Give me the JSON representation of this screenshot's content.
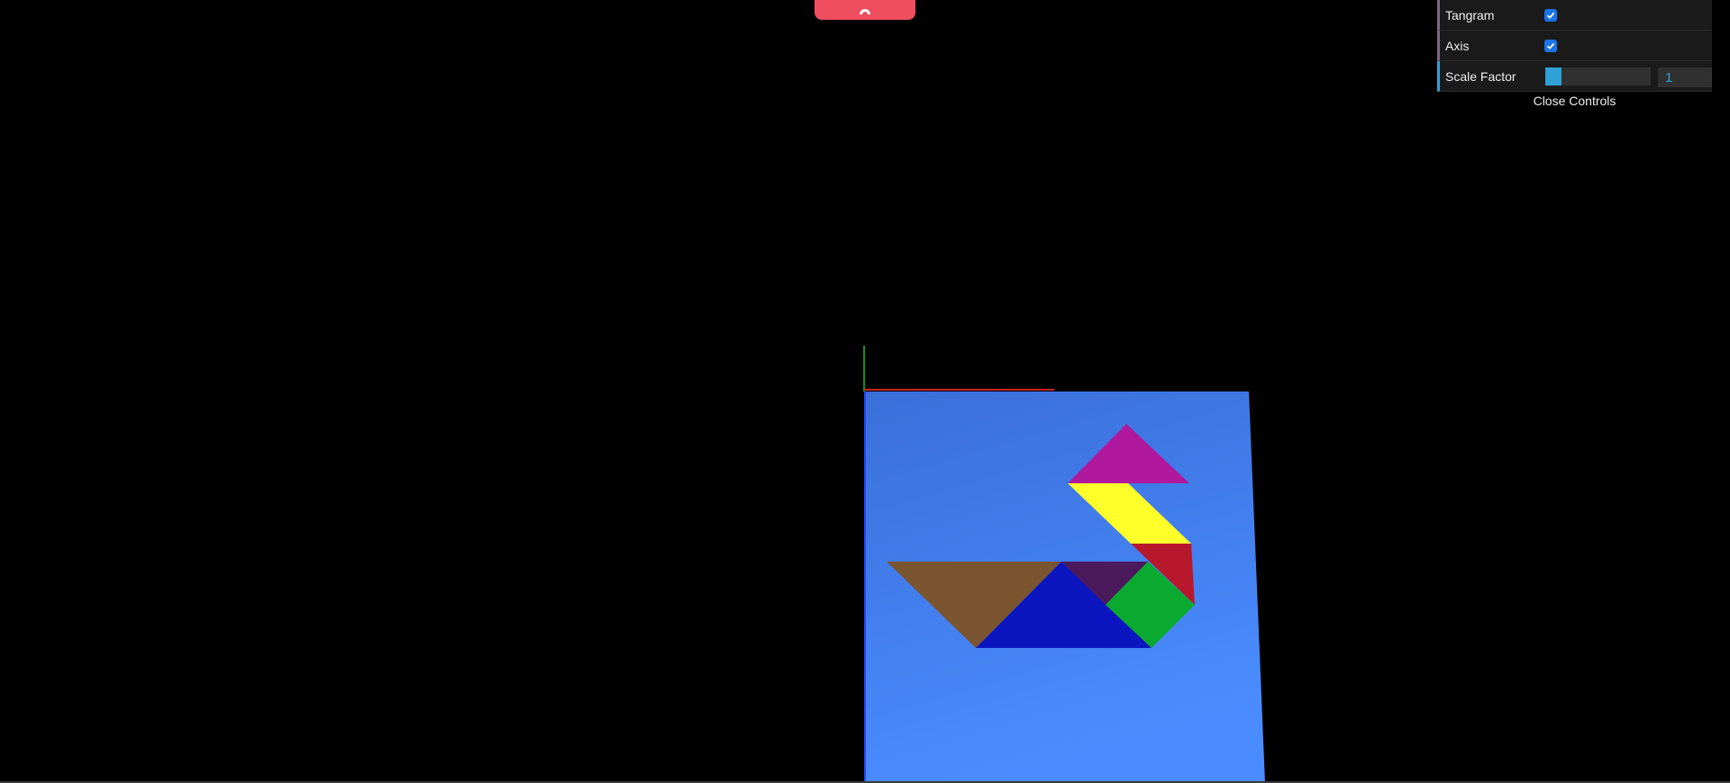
{
  "controls": {
    "tangram_label": "Tangram",
    "tangram_checked": true,
    "axis_label": "Axis",
    "axis_checked": true,
    "scale_label": "Scale Factor",
    "scale_value": "1",
    "scale_fill_fraction": 0.15,
    "close_label": "Close Controls"
  },
  "icons": {
    "top_tab": "toggle-tab-icon",
    "checkbox": "checkmark-icon"
  },
  "colors": {
    "background": "#000000",
    "tab": "#ee4e5e",
    "plane": "#4080f0",
    "piece_magenta": "#b0189e",
    "piece_yellow": "#ffff2a",
    "piece_red": "#b8182c",
    "piece_brown": "#7a5530",
    "piece_navy": "#0b16c0",
    "piece_purple": "#4a1a5c",
    "piece_green": "#0aaa30",
    "axis_x": "#cc2222",
    "axis_y": "#22bb22",
    "axis_z": "#2244ff"
  }
}
